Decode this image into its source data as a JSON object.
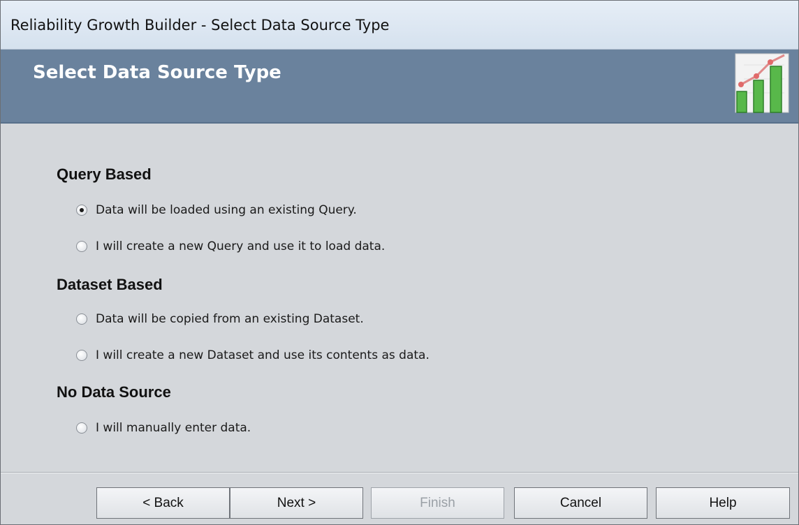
{
  "window": {
    "title": "Reliability Growth Builder - Select Data Source Type"
  },
  "header": {
    "title": "Select Data Source Type",
    "icon": "growth-chart-icon"
  },
  "groups": [
    {
      "heading": "Query Based",
      "options": [
        {
          "label": "Data will be loaded using an existing Query.",
          "selected": true
        },
        {
          "label": "I will create a new Query and use it to load data.",
          "selected": false
        }
      ]
    },
    {
      "heading": "Dataset Based",
      "options": [
        {
          "label": "Data will be copied from an existing Dataset.",
          "selected": false
        },
        {
          "label": "I will create a new Dataset and use its contents as data.",
          "selected": false
        }
      ]
    },
    {
      "heading": "No Data Source",
      "options": [
        {
          "label": "I will manually enter data.",
          "selected": false
        }
      ]
    }
  ],
  "buttons": {
    "back": {
      "label": "< Back",
      "enabled": true
    },
    "next": {
      "label": "Next >",
      "enabled": true
    },
    "finish": {
      "label": "Finish",
      "enabled": false
    },
    "cancel": {
      "label": "Cancel",
      "enabled": true
    },
    "help": {
      "label": "Help",
      "enabled": true
    }
  }
}
